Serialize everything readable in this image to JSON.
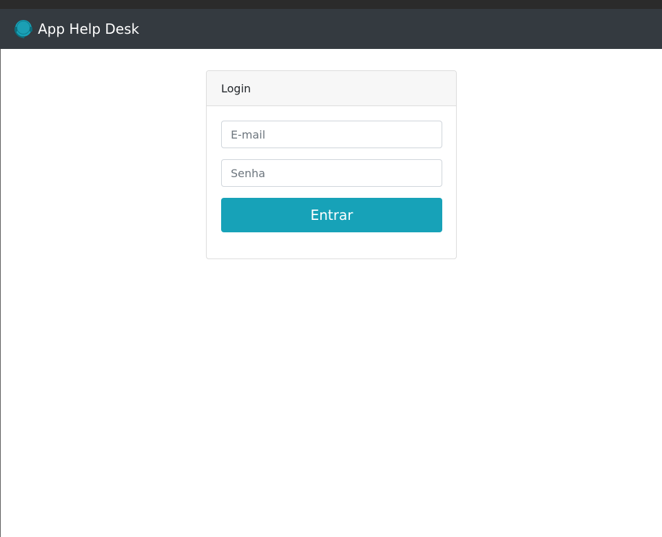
{
  "navbar": {
    "brand_text": "App Help Desk",
    "brand_icon": "headset-icon"
  },
  "login": {
    "title": "Login",
    "email_placeholder": "E-mail",
    "password_placeholder": "Senha",
    "submit_label": "Entrar"
  },
  "colors": {
    "navbar_bg": "#343a40",
    "accent": "#17a2b8",
    "card_header_bg": "#f7f7f7"
  }
}
